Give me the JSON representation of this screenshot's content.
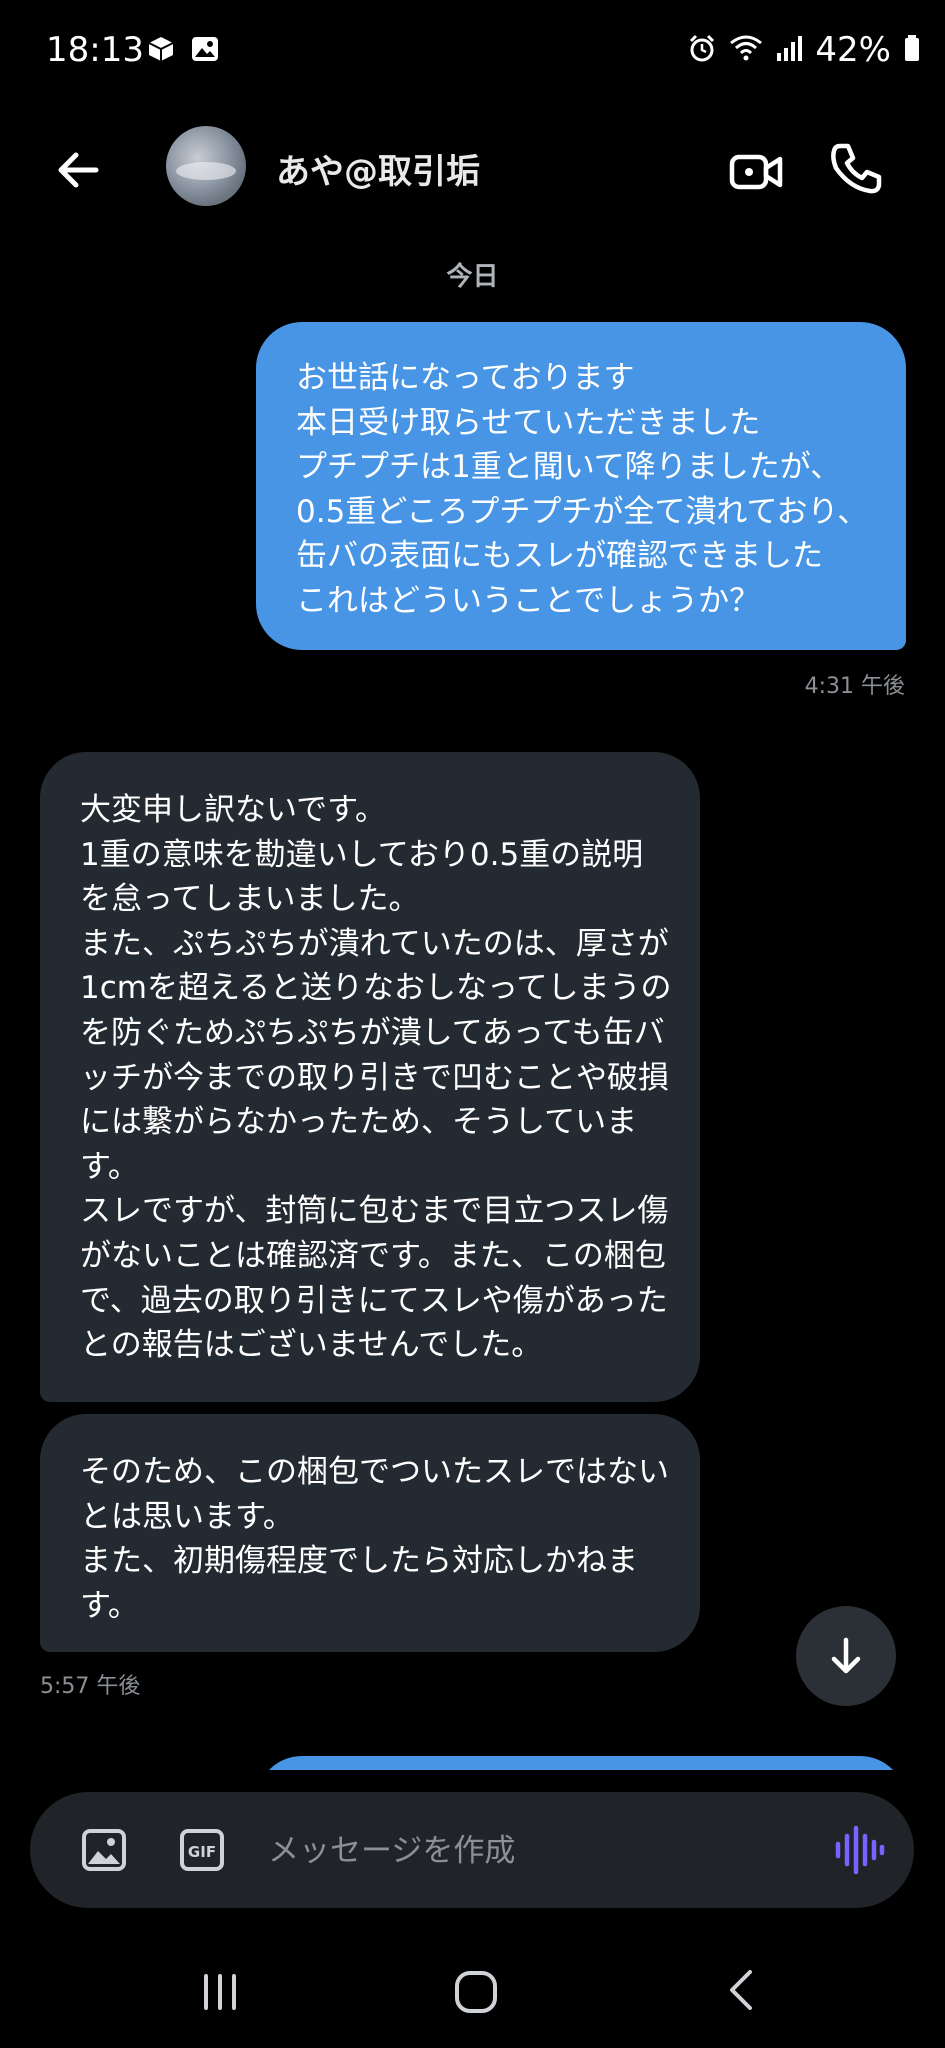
{
  "status_bar": {
    "time": "18:13",
    "battery": "42%"
  },
  "header": {
    "contact_name": "あや@取引垢"
  },
  "date_divider": "今日",
  "messages": [
    {
      "direction": "sent",
      "text": "お世話になっております\n本日受け取らせていただきました\nプチプチは1重と聞いて降りましたが、\n0.5重どころプチプチが全て潰れており、\n缶バの表面にもスレが確認できました\nこれはどういうことでしょうか？"
    },
    {
      "direction": "received",
      "text": "大変申し訳ないです。\n1重の意味を勘違いしており0.5重の説明\nを怠ってしまいました。\nまた、ぷちぷちが潰れていたのは、厚さが\n1cmを超えると送りなおしなってしまうの\nを防ぐためぷちぷちが潰してあっても缶バ\nッチが今までの取り引きで凹むことや破損\nには繋がらなかったため、そうしていま\nす。\nスレですが、封筒に包むまで目立つスレ傷\nがないことは確認済です。また、この梱包\nで、過去の取り引きにてスレや傷があった\nとの報告はございませんでした。"
    },
    {
      "direction": "received",
      "text": "そのため、この梱包でついたスレではない\nとは思います。\nまた、初期傷程度でしたら対応しかねま\nす。"
    }
  ],
  "timestamps": {
    "sent_1": "4:31 午後",
    "received_1": "5:57 午後"
  },
  "composer": {
    "placeholder": "メッセージを作成"
  },
  "colors": {
    "sent_bubble": "#4795e4",
    "received_bubble": "#242a31",
    "voice_icon": "#7b61ff"
  }
}
